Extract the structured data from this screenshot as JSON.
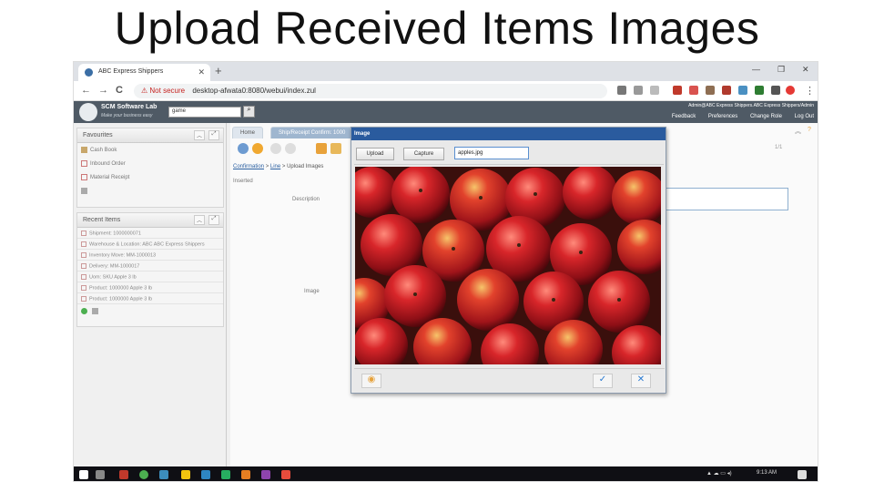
{
  "slide": {
    "title": "Upload Received Items Images"
  },
  "browser": {
    "tab_title": "ABC Express Shippers",
    "tab_close": "✕",
    "new_tab": "+",
    "win_min": "—",
    "win_max": "❐",
    "win_close": "✕",
    "back": "←",
    "forward": "→",
    "reload": "C",
    "security_warning": "⚠ Not secure",
    "url": "desktop-afwata0:8080/webui/index.zul",
    "menu": "⋮"
  },
  "app_header": {
    "brand_name": "SCM Software Lab",
    "brand_tagline": "Make your business easy",
    "global_search_value": "game",
    "user_line": "Admin@ABC Express Shippers.ABC Express Shippers/Admin",
    "links": [
      "Feedback",
      "Preferences",
      "Change Role",
      "Log Out"
    ]
  },
  "favourites": {
    "header": "Favourites",
    "items": [
      "Cash Book",
      "Inbound Order",
      "Material Receipt"
    ]
  },
  "recent": {
    "header": "Recent Items",
    "items": [
      "Shipment: 1000000071",
      "Warehouse & Location: ABC ABC Express Shippers",
      "Inventory Move: MM-1000013",
      "Delivery: MM-1000017",
      "Uom: SKU Apple 3 lb",
      "Product: 1000000 Apple 3 lb",
      "Product: 1000000 Apple 3 lb"
    ]
  },
  "main": {
    "tabs": [
      "Home",
      "Ship/Receipt Confirm: 1000"
    ],
    "breadcrumb": [
      "Confirmation",
      "Line",
      "Upload Images"
    ],
    "breadcrumb_sep": ">",
    "inserted_label": "Inserted",
    "description_label": "Description",
    "image_label": "Image",
    "record_nav": "1/1"
  },
  "modal": {
    "title": "Image",
    "upload_label": "Upload",
    "capture_label": "Capture",
    "file_name": "apples.jpg",
    "ok_icon": "✓",
    "cancel_icon": "✕"
  },
  "taskbar": {
    "time": "9:13 AM"
  },
  "colors": {
    "header_bg": "#4f5a65",
    "modal_title_bg": "#2a5b9e",
    "link_blue": "#2a5fa0"
  }
}
